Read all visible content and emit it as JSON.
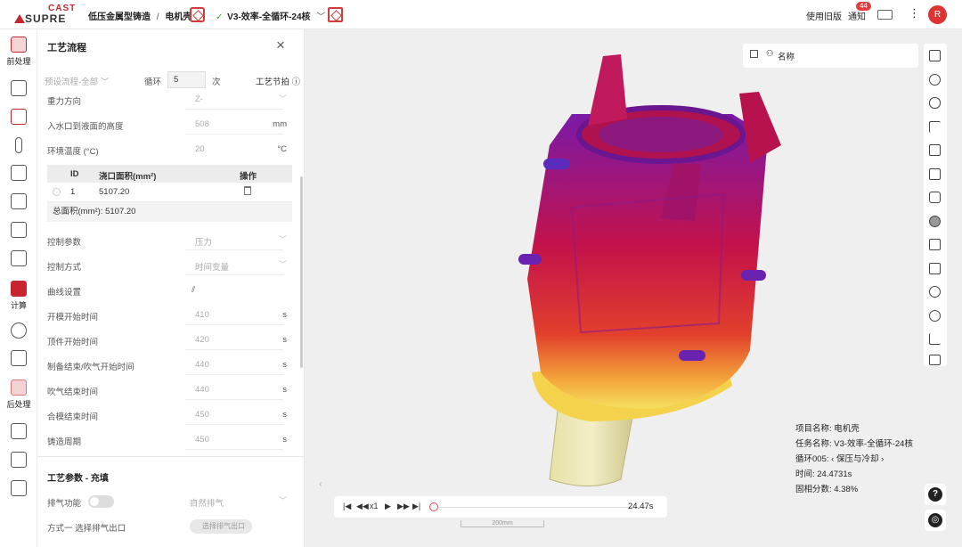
{
  "header": {
    "logo_top": "CAST",
    "logo_bottom": "SUPRE",
    "breadcrumb": [
      "低压金属型铸造",
      "/",
      "电机壳"
    ],
    "task_title": "V3-效率-全循环-24核",
    "use_old": "使用旧版",
    "notify": "通知",
    "notify_count": "44",
    "avatar": "R"
  },
  "nav": [
    {
      "label": "前处理",
      "icon": "preprocess-icon"
    },
    {
      "label": "",
      "icon": "geometry-icon"
    },
    {
      "label": "",
      "icon": "mesh-icon"
    },
    {
      "label": "",
      "icon": "thermometer-icon"
    },
    {
      "label": "",
      "icon": "document-icon"
    },
    {
      "label": "",
      "icon": "material-icon"
    },
    {
      "label": "",
      "icon": "transfer-icon"
    },
    {
      "label": "",
      "icon": "sliders-icon"
    },
    {
      "label": "计算",
      "icon": "compute-icon"
    },
    {
      "label": "",
      "icon": "cloud-icon"
    },
    {
      "label": "",
      "icon": "monitor-icon"
    },
    {
      "label": "后处理",
      "icon": "postprocess-icon"
    },
    {
      "label": "",
      "icon": "cube-icon"
    },
    {
      "label": "",
      "icon": "play-icon"
    },
    {
      "label": "",
      "icon": "pdf-icon"
    }
  ],
  "panel": {
    "title": "工艺流程",
    "preset": "预设流程-全部",
    "cycle_label": "循环",
    "cycle_value": "5",
    "cycle_unit": "次",
    "beat_label": "工艺节拍",
    "rows_top": [
      {
        "label": "重力方向",
        "value": "Z-",
        "unit": "",
        "dropdown": true
      },
      {
        "label": "入水口到液面的高度",
        "value": "508",
        "unit": "mm",
        "dropdown": false
      },
      {
        "label": "环境温度 (°C)",
        "value": "20",
        "unit": "°C",
        "dropdown": false
      }
    ],
    "table": {
      "headers": [
        "ID",
        "浇口面积(mm²)",
        "操作"
      ],
      "rows": [
        {
          "id": "1",
          "area": "5107.20"
        }
      ],
      "total": "总面积(mm²): 5107.20"
    },
    "rows_bottom": [
      {
        "label": "控制参数",
        "value": "压力",
        "unit": "",
        "dropdown": true
      },
      {
        "label": "控制方式",
        "value": "时间变量",
        "unit": "",
        "dropdown": true
      },
      {
        "label": "曲线设置",
        "value": "",
        "unit": "",
        "dropdown": false
      },
      {
        "label": "开模开始时间",
        "value": "410",
        "unit": "s",
        "dropdown": false
      },
      {
        "label": "顶件开始时间",
        "value": "420",
        "unit": "s",
        "dropdown": false
      },
      {
        "label": "制备结束/吹气开始时间",
        "value": "440",
        "unit": "s",
        "dropdown": false
      },
      {
        "label": "吹气结束时间",
        "value": "440",
        "unit": "s",
        "dropdown": false
      },
      {
        "label": "合模结束时间",
        "value": "450",
        "unit": "s",
        "dropdown": false
      },
      {
        "label": "铸造周期",
        "value": "450",
        "unit": "s",
        "dropdown": false
      }
    ],
    "section2_title": "工艺参数 - 充填",
    "vent_label": "排气功能",
    "vent_value": "自然排气",
    "method_label": "方式一 选择排气出口",
    "method_btn": "选择排气出口"
  },
  "viewport": {
    "name_label": "名称",
    "info": {
      "project": "项目名称: 电机壳",
      "task": "任务名称: V3-效率-全循环-24核",
      "cycle_prefix": "循环005:",
      "cycle_stage": "保压与冷却",
      "time": "时间: 24.4731s",
      "solid": "固相分数: 4.38%"
    },
    "player": {
      "speed": "x1",
      "time": "24.47s",
      "progress": 0.0
    },
    "scale_label": "200mm"
  }
}
